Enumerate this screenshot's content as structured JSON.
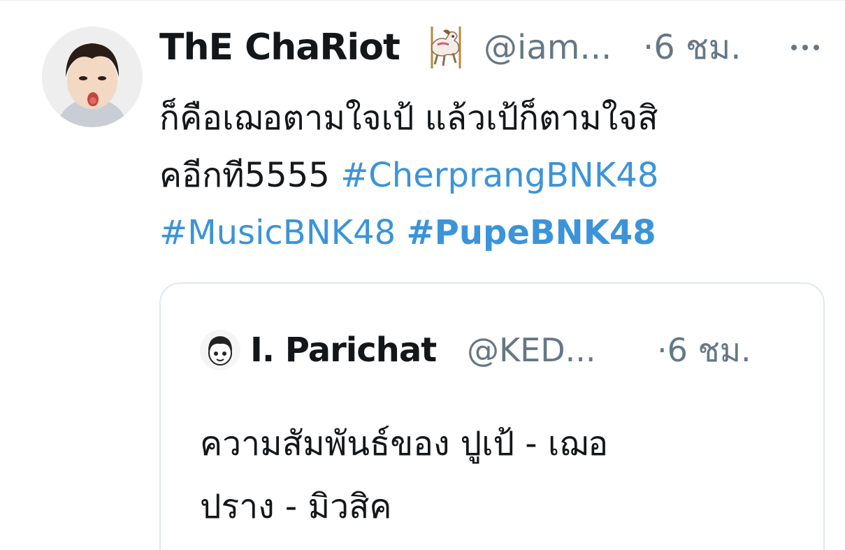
{
  "tweet": {
    "display_name": "ThE ChaRiot",
    "name_emoji_icon": "carousel-horse-icon",
    "handle": "@iam...",
    "timestamp": "·6 ชม.",
    "more_icon": "more-dots-icon",
    "text_line1": "ก็คือเฌอตามใจเป้ แล้วเป้ก็ตามใจสิ",
    "text_line2_prefix": "คอีกที5555 ",
    "hashtags": [
      "#CherprangBNK48",
      "#MusicBNK48",
      "#PupeBNK48"
    ]
  },
  "quote": {
    "display_name": "I. Parichat",
    "handle": "@KED...",
    "timestamp": "·6 ชม.",
    "text_line1": "ความสัมพันธ์ของ ปูเป้ - เฌอ",
    "text_line2": "ปราง - มิวสิค"
  },
  "colors": {
    "text": "#14171a",
    "secondary": "#657786",
    "link": "#3b94d9",
    "border": "#e1e8ed"
  }
}
